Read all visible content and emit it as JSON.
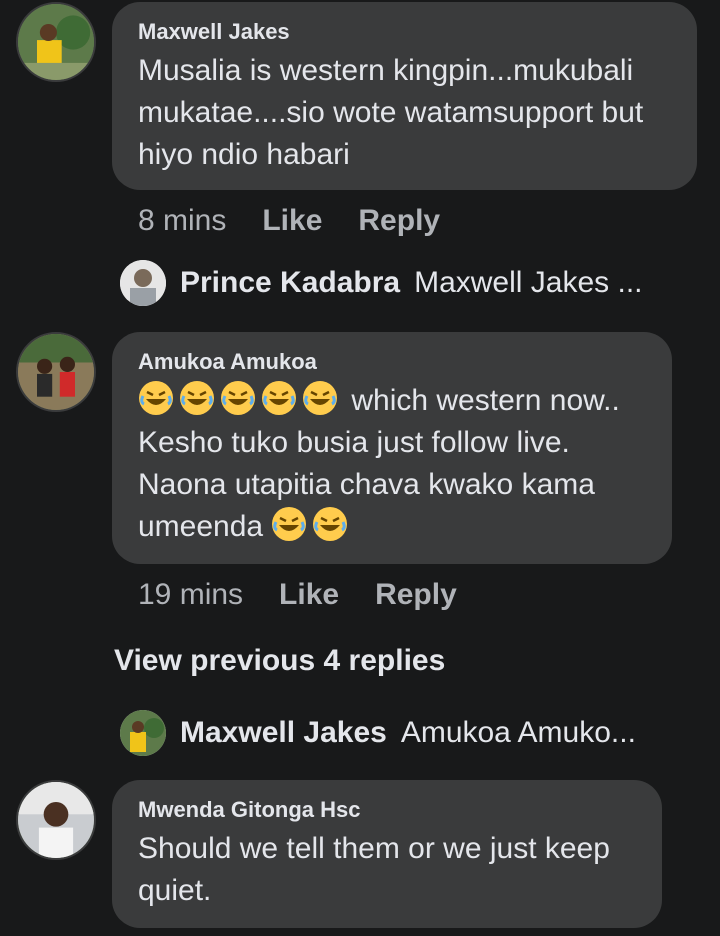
{
  "comments": [
    {
      "author": "Maxwell Jakes",
      "text": "Musalia is western kingpin...mukubali mukatae....sio wote watamsupport but hiyo ndio habari",
      "time": "8 mins",
      "like": "Like",
      "reply": "Reply"
    },
    {
      "author": "Amukoa Amukoa",
      "emoji_icon": "rolling-on-floor-laughing-emoji",
      "text_line1": "which western now..",
      "text_rest": "Kesho tuko busia just follow live. Naona utapitia chava kwako kama umeenda",
      "time": "19 mins",
      "like": "Like",
      "reply": "Reply"
    },
    {
      "author": "Mwenda Gitonga Hsc",
      "text": "Should we tell them or we just keep quiet."
    }
  ],
  "replies": [
    {
      "author": "Prince Kadabra",
      "preview": "Maxwell Jakes ..."
    },
    {
      "author": "Maxwell Jakes",
      "preview": "Amukoa Amuko..."
    }
  ],
  "view_previous": "View previous 4 replies",
  "colors": {
    "background": "#18191a",
    "bubble": "#3a3b3c",
    "text": "#e4e6eb",
    "muted": "#b0b3b8"
  }
}
